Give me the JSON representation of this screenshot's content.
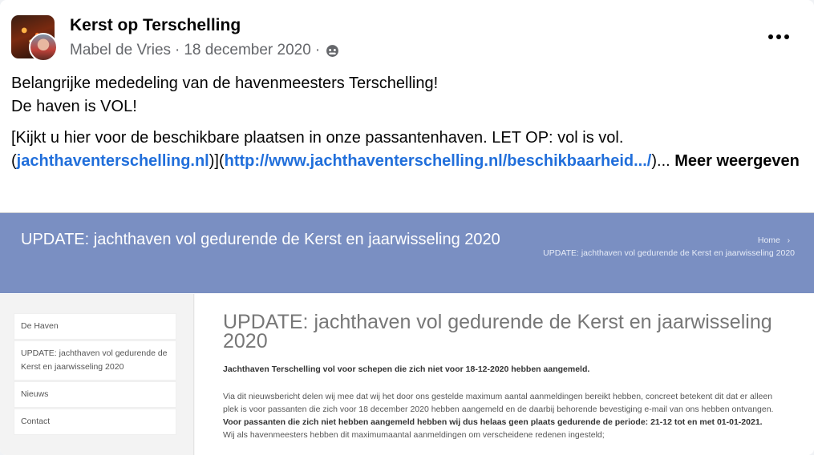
{
  "post": {
    "page_name": "Kerst op Terschelling",
    "author": "Mabel de Vries",
    "separator": "·",
    "date": "18 december 2020",
    "separator2": "·",
    "audience_icon": "globe-icon",
    "more_icon": "more-options-icon",
    "line1": "Belangrijke mededeling van de havenmeesters Terschelling!",
    "line2": "De haven is VOL!",
    "para_prefix": "[Kijkt u hier voor de beschikbare plaatsen in onze passantenhaven. LET OP: vol is vol. (",
    "link1": "jachthaventerschelling.nl",
    "mid": ")](",
    "link2": "http://www.jachthaventerschelling.nl/beschikbaarheid.../",
    "suffix": ")... ",
    "see_more": "Meer weergeven"
  },
  "preview": {
    "banner_title": "UPDATE: jachthaven vol gedurende de Kerst en jaarwisseling 2020",
    "breadcrumb_home": "Home",
    "breadcrumb_sep": "›",
    "breadcrumb_current": "UPDATE: jachthaven vol gedurende de Kerst en jaarwisseling 2020",
    "sidebar": [
      "De Haven",
      "UPDATE: jachthaven vol gedurende de Kerst en jaarwisseling 2020",
      "Nieuws",
      "Contact"
    ],
    "article_title": "UPDATE: jachthaven vol gedurende de Kerst en jaarwisseling 2020",
    "article_subtitle": "Jachthaven Terschelling vol voor schepen die zich niet voor 18-12-2020 hebben aangemeld.",
    "article_p1": "Via dit nieuwsbericht delen wij mee dat wij het door ons gestelde maximum aantal aanmeldingen bereikt hebben, concreet betekent dit dat er alleen plek is voor passanten die zich voor 18 december 2020 hebben aangemeld en de daarbij behorende bevestiging e-mail van ons hebben ontvangen.",
    "article_p2": "Voor passanten die zich niet hebben aangemeld hebben wij dus helaas geen plaats gedurende de periode: 21-12 tot en met 01-01-2021.",
    "article_p3": "Wij als havenmeesters hebben dit maximumaantal aanmeldingen om verscheidene redenen ingesteld;"
  },
  "colors": {
    "link": "#216fdb",
    "banner": "#7a8fc2",
    "secondary_text": "#65676b"
  }
}
